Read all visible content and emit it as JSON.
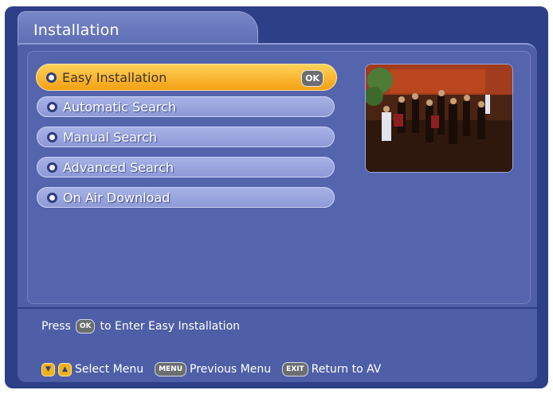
{
  "window": {
    "title": "Installation"
  },
  "menu": {
    "items": [
      {
        "label": "Easy Installation",
        "selected": true
      },
      {
        "label": "Automatic Search",
        "selected": false
      },
      {
        "label": "Manual Search",
        "selected": false
      },
      {
        "label": "Advanced Search",
        "selected": false
      },
      {
        "label": "On Air Download",
        "selected": false
      }
    ],
    "ok_badge": "OK"
  },
  "preview": {
    "icon": "tv-preview-image"
  },
  "hint": {
    "prefix": "Press",
    "key": "OK",
    "suffix": "to Enter Easy Installation"
  },
  "legend": {
    "select_label": "Select Menu",
    "menu_key": "MENU",
    "menu_label": "Previous Menu",
    "exit_key": "EXIT",
    "exit_label": "Return to AV"
  },
  "colors": {
    "background": "#2d3f86",
    "selected": "#f5a012",
    "item": "#8d9ad7"
  }
}
